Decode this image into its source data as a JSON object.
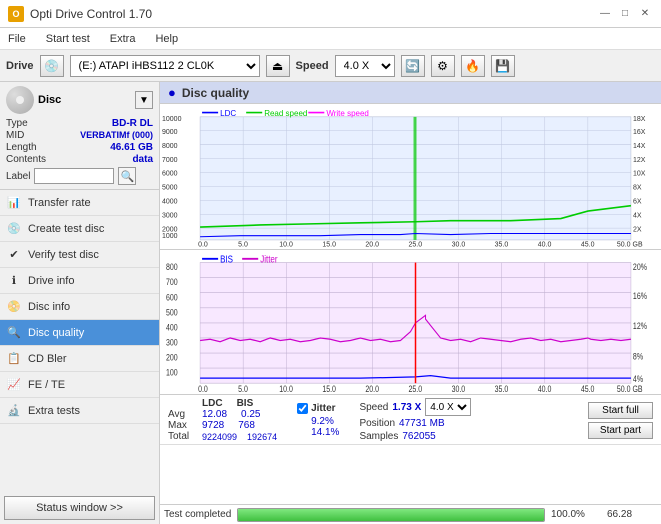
{
  "titleBar": {
    "title": "Opti Drive Control 1.70",
    "icon": "O",
    "controls": [
      "—",
      "□",
      "✕"
    ]
  },
  "menuBar": {
    "items": [
      "File",
      "Start test",
      "Extra",
      "Help"
    ]
  },
  "toolbar": {
    "driveLabel": "Drive",
    "driveValue": "(E:) ATAPI iHBS112  2 CL0K",
    "speedLabel": "Speed",
    "speedValue": "4.0 X"
  },
  "disc": {
    "typeLabel": "Type",
    "typeValue": "BD-R DL",
    "midLabel": "MID",
    "midValue": "VERBATIMf (000)",
    "lengthLabel": "Length",
    "lengthValue": "46.61 GB",
    "contentsLabel": "Contents",
    "contentsValue": "data",
    "labelLabel": "Label",
    "labelValue": ""
  },
  "nav": {
    "items": [
      {
        "id": "transfer-rate",
        "label": "Transfer rate",
        "icon": "📊"
      },
      {
        "id": "create-test-disc",
        "label": "Create test disc",
        "icon": "💿"
      },
      {
        "id": "verify-test-disc",
        "label": "Verify test disc",
        "icon": "✔"
      },
      {
        "id": "drive-info",
        "label": "Drive info",
        "icon": "ℹ"
      },
      {
        "id": "disc-info",
        "label": "Disc info",
        "icon": "📀"
      },
      {
        "id": "disc-quality",
        "label": "Disc quality",
        "icon": "🔍",
        "active": true
      },
      {
        "id": "cd-bler",
        "label": "CD Bler",
        "icon": "📋"
      },
      {
        "id": "fe-te",
        "label": "FE / TE",
        "icon": "📈"
      },
      {
        "id": "extra-tests",
        "label": "Extra tests",
        "icon": "🔬"
      }
    ],
    "statusBtn": "Status window >>"
  },
  "discQuality": {
    "title": "Disc quality"
  },
  "chart1": {
    "title": "LDC",
    "legendLDC": "LDC",
    "legendRead": "Read speed",
    "legendWrite": "Write speed",
    "yMax": 10000,
    "yLabels": [
      "10000",
      "9000",
      "8000",
      "7000",
      "6000",
      "5000",
      "4000",
      "3000",
      "2000",
      "1000"
    ],
    "yRight": [
      "18X",
      "16X",
      "14X",
      "12X",
      "10X",
      "8X",
      "6X",
      "4X",
      "2X"
    ],
    "xLabels": [
      "0.0",
      "5.0",
      "10.0",
      "15.0",
      "20.0",
      "25.0",
      "30.0",
      "35.0",
      "40.0",
      "45.0",
      "50.0 GB"
    ]
  },
  "chart2": {
    "legendBIS": "BIS",
    "legendJitter": "Jitter",
    "yMax": 800,
    "yLabels": [
      "800",
      "700",
      "600",
      "500",
      "400",
      "300",
      "200",
      "100"
    ],
    "yRight": [
      "20%",
      "16%",
      "12%",
      "8%",
      "4%"
    ],
    "xLabels": [
      "0.0",
      "5.0",
      "10.0",
      "15.0",
      "20.0",
      "25.0",
      "30.0",
      "35.0",
      "40.0",
      "45.0",
      "50.0 GB"
    ]
  },
  "stats": {
    "columns": {
      "ldc": "LDC",
      "bis": "BIS",
      "jitter": "Jitter"
    },
    "rows": {
      "avg": {
        "label": "Avg",
        "ldc": "12.08",
        "bis": "0.25",
        "jitter": "9.2%"
      },
      "max": {
        "label": "Max",
        "ldc": "9728",
        "bis": "768",
        "jitter": "14.1%"
      },
      "total": {
        "label": "Total",
        "ldc": "9224099",
        "bis": "192674",
        "jitter": ""
      }
    },
    "jitterChecked": true,
    "speed": {
      "label": "Speed",
      "value": "1.73 X",
      "selectValue": "4.0 X"
    },
    "position": {
      "label": "Position",
      "value": "47731 MB"
    },
    "samples": {
      "label": "Samples",
      "value": "762055"
    },
    "buttons": {
      "startFull": "Start full",
      "startPart": "Start part"
    }
  },
  "statusBar": {
    "statusText": "Test completed",
    "progressPercent": 100,
    "progressLabel": "100.0%",
    "timeValue": "66.28"
  }
}
